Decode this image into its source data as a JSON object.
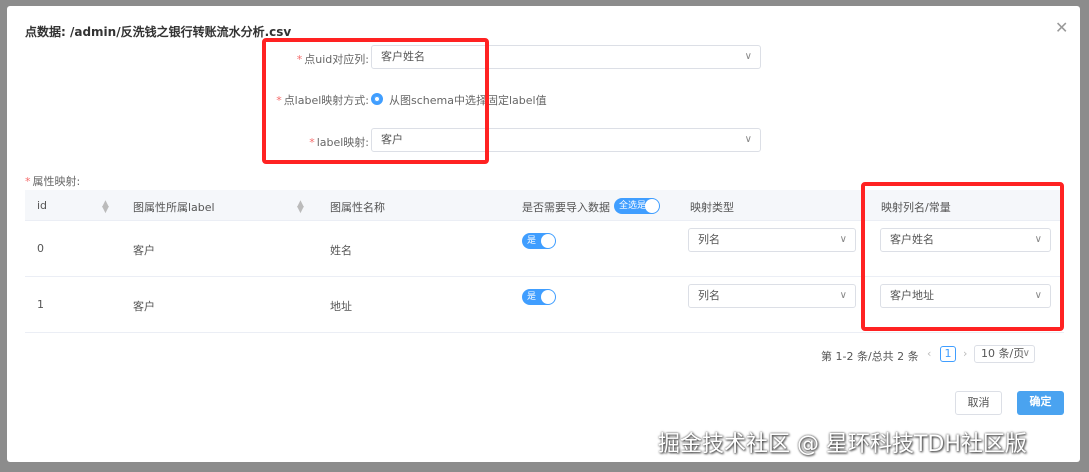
{
  "dialog": {
    "title": "点数据: /admin/反洗钱之银行转账流水分析.csv",
    "close_icon": "close-icon"
  },
  "form": {
    "uid_label": "点uid对应列:",
    "uid_value": "客户姓名",
    "label_mode_label": "点label映射方式:",
    "label_mode_option": "从图schema中选择固定label值",
    "label_map_label": "label映射:",
    "label_map_value": "客户"
  },
  "table": {
    "section_label": "属性映射:",
    "headers": [
      "id",
      "图属性所属label",
      "图属性名称",
      "是否需要导入数据",
      "映射类型",
      "映射列名/常量"
    ],
    "select_all_label": "全选是",
    "rows": [
      {
        "id": "0",
        "label": "客户",
        "name": "姓名",
        "import": "是",
        "type": "列名",
        "column": "客户姓名"
      },
      {
        "id": "1",
        "label": "客户",
        "name": "地址",
        "import": "是",
        "type": "列名",
        "column": "客户地址"
      }
    ]
  },
  "pagination": {
    "summary": "第 1-2 条/总共 2 条",
    "page": "1",
    "page_size": "10 条/页"
  },
  "footer": {
    "cancel": "取消",
    "confirm": "确定"
  },
  "watermark": "掘金技术社区 @ 星环科技TDH社区版",
  "colors": {
    "accent": "#409eff",
    "highlight": "#ff2222"
  }
}
